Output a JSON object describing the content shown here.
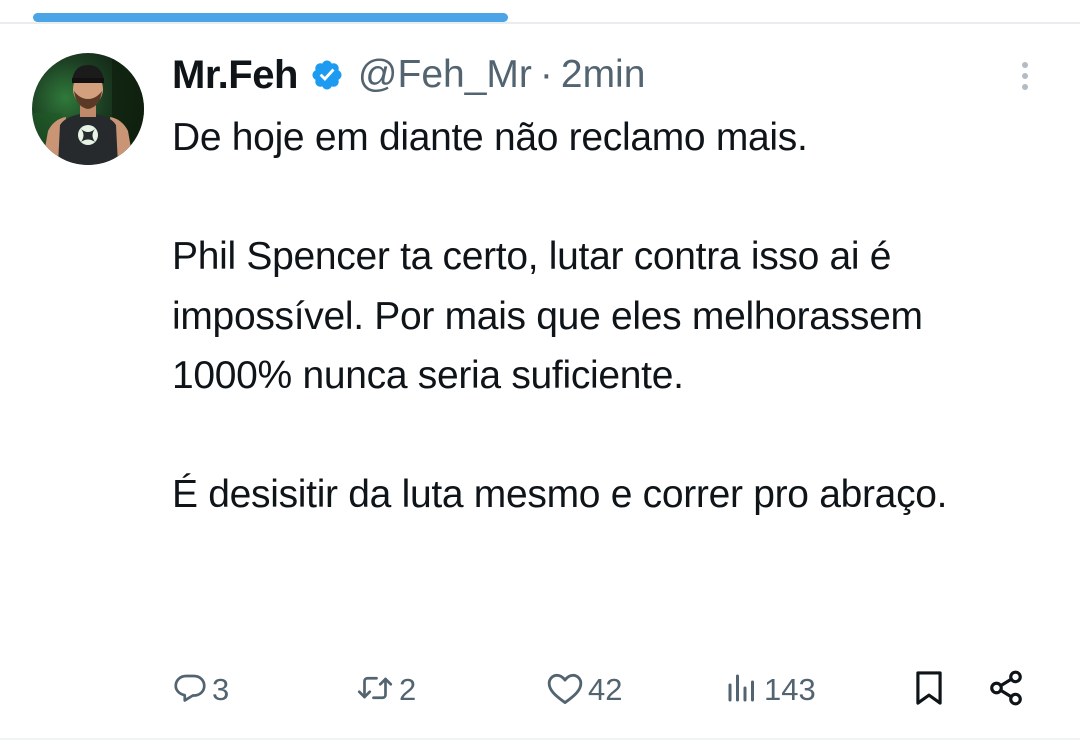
{
  "progress": {
    "value": 0.44,
    "color": "#4aa4e6"
  },
  "author": {
    "display_name": "Mr.Feh",
    "verified": true,
    "handle": "@Feh_Mr",
    "separator": "·",
    "time": "2min"
  },
  "tweet": {
    "paragraphs": [
      "De hoje em diante não reclamo mais.",
      "Phil Spencer ta certo, lutar contra isso ai é impossível. Por mais que eles melhorassem 1000% nunca seria suficiente.",
      "É desisitir da luta mesmo e correr pro abraço."
    ]
  },
  "actions": {
    "replies": "3",
    "retweets": "2",
    "likes": "42",
    "views": "143"
  },
  "colors": {
    "text": "#0f1419",
    "secondary": "#536471",
    "verified": "#1d9bf0",
    "accent": "#4aa4e6"
  },
  "icons": [
    "reply-icon",
    "retweet-icon",
    "like-icon",
    "views-icon",
    "bookmark-icon",
    "share-icon",
    "more-icon",
    "verified-icon"
  ]
}
